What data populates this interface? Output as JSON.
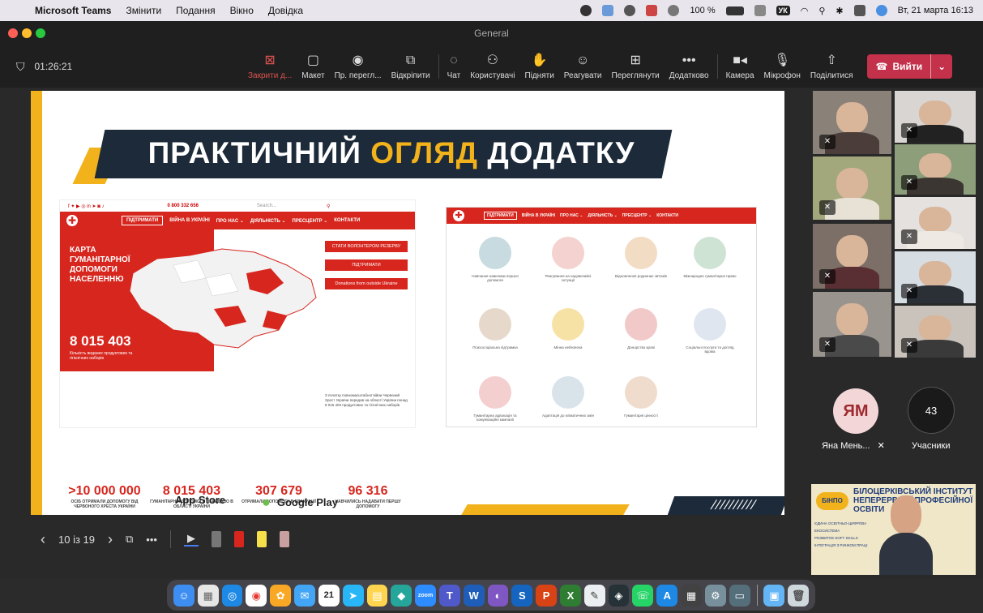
{
  "menubar": {
    "app_name": "Microsoft Teams",
    "items": [
      "Змінити",
      "Подання",
      "Вікно",
      "Довідка"
    ],
    "battery": "100 %",
    "keyboard_layout": "УК",
    "datetime": "Вт, 21 марта  16:13"
  },
  "window": {
    "title": "General"
  },
  "toolbar": {
    "timer": "01:26:21",
    "buttons": [
      {
        "label": "Закрити д...",
        "icon": "close-share-icon"
      },
      {
        "label": "Макет",
        "icon": "layout-icon"
      },
      {
        "label": "Пр. перегл...",
        "icon": "eye-icon"
      },
      {
        "label": "Відкріпити",
        "icon": "pop-out-icon"
      },
      {
        "label": "Чат",
        "icon": "chat-icon"
      },
      {
        "label": "Користувачі",
        "icon": "people-icon"
      },
      {
        "label": "Підняти",
        "icon": "hand-icon"
      },
      {
        "label": "Реагувати",
        "icon": "smile-icon"
      },
      {
        "label": "Переглянути",
        "icon": "rooms-icon"
      },
      {
        "label": "Додатково",
        "icon": "more-icon"
      },
      {
        "label": "Камера",
        "icon": "camera-icon"
      },
      {
        "label": "Мікрофон",
        "icon": "mic-icon"
      },
      {
        "label": "Поділитися",
        "icon": "share-icon"
      }
    ],
    "leave_label": "Вийти"
  },
  "slide": {
    "title_part1": "ПРАКТИЧНИЙ",
    "title_highlight": "ОГЛЯД",
    "title_part2": "ДОДАТКУ",
    "site1": {
      "phone": "0 800 332 656",
      "search_placeholder": "Search...",
      "nav": [
        "ПІДТРИМАТИ",
        "ВІЙНА В УКРАЇНІ",
        "ПРО НАС ⌄",
        "ДІЯЛЬНІСТЬ ⌄",
        "ПРЕСЦЕНТР ⌄",
        "КОНТАКТИ"
      ],
      "map_title": "КАРТА ГУМАНІТАРНОЇ ДОПОМОГИ НАСЕЛЕННЮ",
      "map_number": "8 015 403",
      "map_sub": "Кількість виданих продуктових та гігієнічних наборів",
      "btn_volunteer": "СТАТИ ВОЛОНТЕРОМ РЕЗЕРВУ",
      "btn_support": "ПІДТРИМАТИ",
      "btn_donations": "Donations from outside Ukraine",
      "desc": "З початку повномасштабної війни Червоний Хрест України передав на області України понад 8 015 403 продуктових та гігієнічних наборів",
      "stats": [
        {
          "value": ">10 000 000",
          "label": "ОСІБ ОТРИМАЛИ ДОПОМОГУ ВІД ЧЕРВОНОГО ХРЕСТА УКРАЇНИ"
        },
        {
          "value": "8 015 403",
          "label": "ГУМАНІТАРНОЇ ДОПОМОГИ ПЕРЕДАНО В ОБЛАСТІ УКРАЇНИ"
        },
        {
          "value": "307 679",
          "label": "ОТРИМАЛИ ДОПОМОГУ В ЕВАКУАЦІЇ"
        },
        {
          "value": "96 316",
          "label": "НАВЧИЛИСЬ НАДАВАТИ ПЕРШУ ДОПОМОГУ"
        }
      ]
    },
    "site2": {
      "nav": [
        "ПІДТРИМАТИ",
        "ВІЙНА В УКРАЇНІ",
        "ПРО НАС ⌄",
        "ДІЯЛЬНІСТЬ ⌄",
        "ПРЕСЦЕНТР ⌄",
        "КОНТАКТИ"
      ],
      "items": [
        "Навчання навичкам першої допомоги",
        "Реагування на надзвичайні ситуації",
        "Відновлення родинних зв'язків",
        "Міжнародне гуманітарне право",
        "Психосоціальна підтримка",
        "Мінна небезпека",
        "Донорство крові",
        "Соціальні послуги та догляд вдома",
        "Гуманітарна адвокація та комунікаційні кампанії",
        "Адаптація до кліматичних змін",
        "Гуманітарні цінності"
      ]
    },
    "app_store": "App Store",
    "google_play": "Google Play"
  },
  "presenter_controls": {
    "page_indicator": "10 із 19"
  },
  "participants": {
    "ym_initials": "ЯМ",
    "ym_name": "Яна Мень...",
    "count": "43",
    "count_label": "Учасники"
  },
  "presenter_video": {
    "institute": "БІЛОЦЕРКІВСЬКИЙ ІНСТИТУТ НЕПЕРЕРВНОЇ ПРОФЕСІЙНОЇ ОСВІТИ",
    "bullets": [
      "ЄДИНА ОСВІТНЬО-ЦИФРОВА ЕКОСИСТЕМА",
      "РОЗВИТОК SOFT SKILLS",
      "ІНТЕГРАЦІЯ З РИНКОМ ПРАЦІ"
    ]
  },
  "dock": {
    "calendar_day": "21"
  },
  "colors": {
    "teams_red": "#c4314b",
    "red_cross": "#d7261e",
    "accent_yellow": "#f2b21b",
    "navy": "#1d2a3a"
  }
}
